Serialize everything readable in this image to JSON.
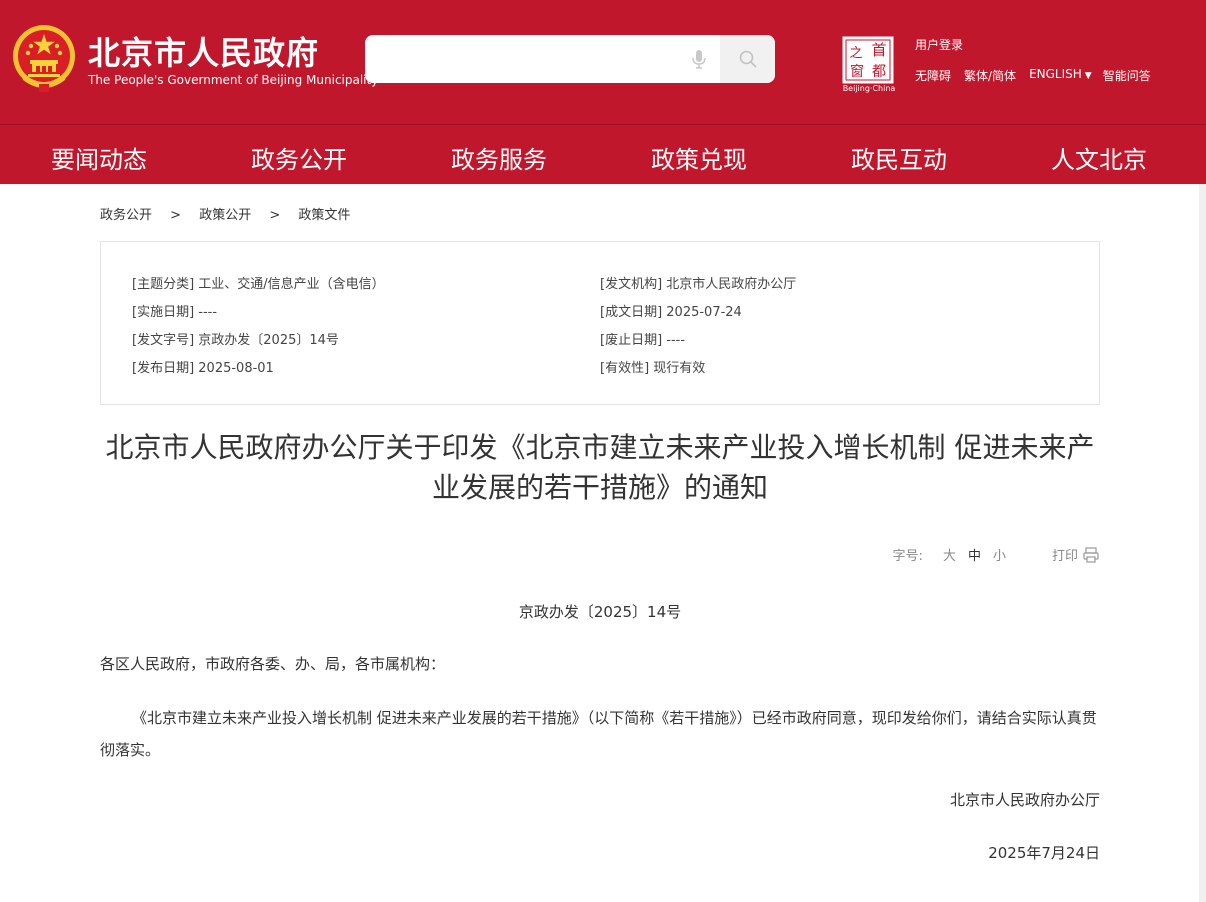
{
  "header": {
    "site_title": "北京市人民政府",
    "site_subtitle": "The People's Government of Beijing Municipality",
    "search_placeholder": "",
    "capital_logo_chars": [
      "之",
      "首",
      "窗",
      "都"
    ],
    "capital_logo_caption": "Beijing·China",
    "user_login": "用户登录",
    "links": {
      "accessibility": "无障碍",
      "trad_simp": "繁体/简体",
      "english": "ENGLISH",
      "smart_qa": "智能问答"
    },
    "brand_color": "#c0172d"
  },
  "nav": {
    "items": [
      "要闻动态",
      "政务公开",
      "政务服务",
      "政策兑现",
      "政民互动",
      "人文北京"
    ]
  },
  "breadcrumb": {
    "items": [
      "政务公开",
      "政策公开",
      "政策文件"
    ],
    "separator": ">"
  },
  "meta": {
    "topic": "[主题分类] 工业、交通/信息产业（含电信）",
    "issuer": "[发文机构] 北京市人民政府办公厅",
    "effective_date": "[实施日期] ----",
    "formed_date": "[成文日期] 2025-07-24",
    "doc_number": "[发文字号] 京政办发〔2025〕14号",
    "repeal_date": "[废止日期] ----",
    "publish_date": "[发布日期] 2025-08-01",
    "validity": "[有效性] 现行有效"
  },
  "article": {
    "title": "北京市人民政府办公厅关于印发《北京市建立未来产业投入增长机制 促进未来产业发展的若干措施》的通知",
    "font_size_label": "字号:",
    "font_sizes": [
      "大",
      "中",
      "小"
    ],
    "print_label": "打印",
    "doc_number": "京政办发〔2025〕14号",
    "salutation": "各区人民政府，市政府各委、办、局，各市属机构：",
    "body": "《北京市建立未来产业投入增长机制 促进未来产业发展的若干措施》（以下简称《若干措施》）已经市政府同意，现印发给你们，请结合实际认真贯彻落实。",
    "sign_org": "北京市人民政府办公厅",
    "sign_date": "2025年7月24日"
  }
}
